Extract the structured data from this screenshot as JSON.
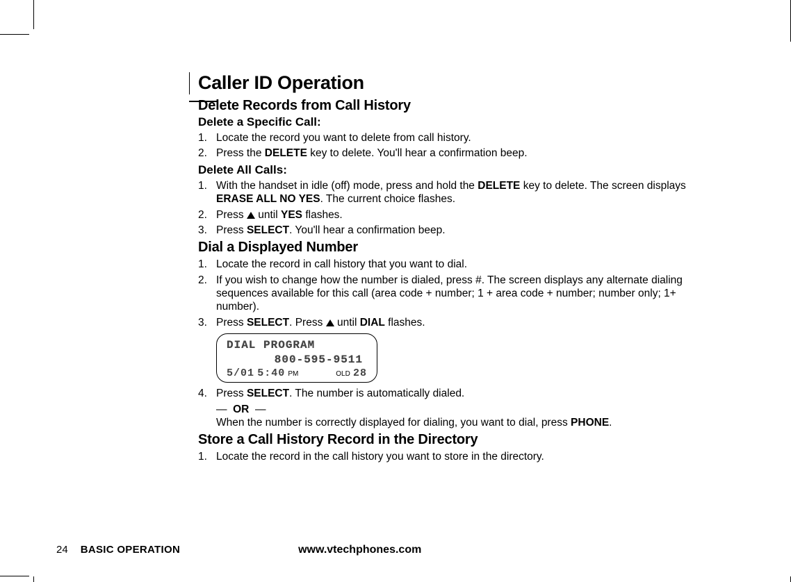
{
  "title": "Caller ID Operation",
  "delete_section": {
    "heading": "Delete Records from Call History",
    "specific": {
      "heading": "Delete a Specific Call:",
      "steps": [
        {
          "n": "1.",
          "text": "Locate the record you want to delete from call history."
        },
        {
          "n": "2.",
          "prefix": "Press the ",
          "bold1": "DELETE",
          "rest": " key to delete. You'll hear a confirmation beep."
        }
      ]
    },
    "all": {
      "heading": "Delete All Calls:",
      "step1": {
        "n": "1.",
        "prefix": "With the handset in idle (off) mode, press and hold the ",
        "bold1": "DELETE",
        "mid": " key to delete. The screen displays ",
        "bold2": "ERASE ALL NO YES",
        "rest": ". The current choice flashes."
      },
      "step2": {
        "n": "2.",
        "prefix": "Press ",
        "mid": " until ",
        "bold1": "YES",
        "rest": " flashes."
      },
      "step3": {
        "n": "3.",
        "prefix": "Press ",
        "bold1": "SELECT",
        "rest": ". You'll hear a confirmation beep."
      }
    }
  },
  "dial_section": {
    "heading": "Dial a Displayed Number",
    "step1": {
      "n": "1.",
      "text": "Locate the record in call history that you want to dial."
    },
    "step2": {
      "n": "2.",
      "text": "If you wish to change how the number is dialed, press #. The screen displays any alternate dialing sequences available for this call (area code + number; 1 + area code + number; number only; 1+ number)."
    },
    "step3": {
      "n": "3.",
      "prefix": "Press ",
      "bold1": "SELECT",
      "mid": ". Press ",
      "mid2": " until ",
      "bold2": "DIAL",
      "rest": " flashes."
    },
    "lcd": {
      "line1": "DIAL PROGRAM",
      "line2": "800-595-9511",
      "date": "5/01",
      "time": "5:40",
      "ampm": "PM",
      "old": "OLD",
      "count": "28"
    },
    "step4": {
      "n": "4.",
      "prefix": "Press ",
      "bold1": "SELECT",
      "rest": ". The number is automatically dialed."
    },
    "or": "—  OR  —",
    "step4b": {
      "prefix": "When the number is correctly displayed for dialing, you want to dial, press ",
      "bold1": "PHONE",
      "rest": "."
    }
  },
  "store_section": {
    "heading": "Store a Call History Record in the Directory",
    "step1": {
      "n": "1.",
      "text": "Locate the record in the call history you want to store in the directory."
    }
  },
  "footer": {
    "page": "24",
    "section": "BASIC OPERATION",
    "url": "www.vtechphones.com"
  }
}
